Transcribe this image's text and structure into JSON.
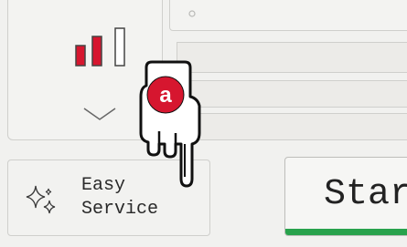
{
  "signal_panel": {
    "bars": [
      {
        "level": 0.5,
        "color": "#d6162f"
      },
      {
        "level": 0.7,
        "color": "#d6162f"
      },
      {
        "level": 1.0,
        "color": "#ffffff"
      }
    ],
    "chevron_icon": "chevron-down-icon"
  },
  "easy_service": {
    "label": "Easy\nService",
    "icon": "sparkle-icon"
  },
  "start_button": {
    "label": "Star",
    "underline_color": "#28a24c"
  },
  "pointer": {
    "icon": "hand-pointer-icon",
    "badge_text": "a",
    "badge_color": "#d6162f"
  },
  "colors": {
    "background": "#f1f1ef",
    "accent_red": "#d6162f",
    "accent_green": "#28a24c"
  }
}
